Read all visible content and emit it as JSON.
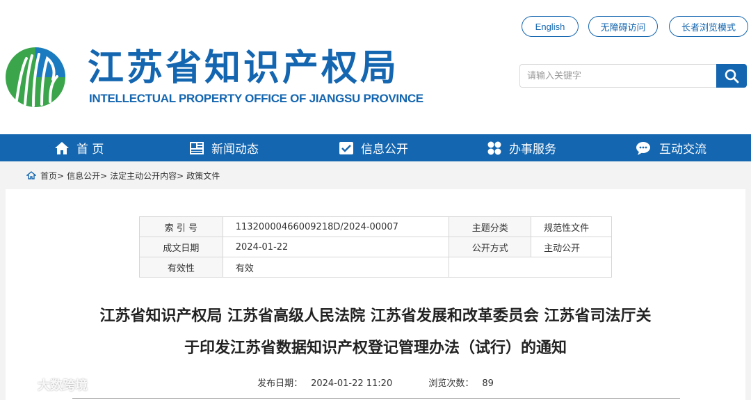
{
  "header": {
    "logo_cn": "江苏省知识产权局",
    "logo_en": "INTELLECTUAL PROPERTY OFFICE OF JIANGSU PROVINCE",
    "btn_english": "English",
    "btn_accessible": "无障碍访问",
    "btn_elder": "长者浏览模式",
    "search_placeholder": "请输入关键字",
    "brand_color": "#1466b0"
  },
  "nav": {
    "items": [
      {
        "label": "首 页",
        "icon": "home-icon"
      },
      {
        "label": "新闻动态",
        "icon": "news-icon"
      },
      {
        "label": "信息公开",
        "icon": "info-icon"
      },
      {
        "label": "办事服务",
        "icon": "service-icon"
      },
      {
        "label": "互动交流",
        "icon": "chat-icon"
      }
    ]
  },
  "breadcrumb": [
    "首页>",
    "信息公开>",
    "法定主动公开内容>",
    "政策文件"
  ],
  "meta": {
    "index_label": "索 引 号",
    "index_value": "11320000466009218D/2024-00007",
    "topic_label": "主题分类",
    "topic_value": "规范性文件",
    "date_label": "成文日期",
    "date_value": "2024-01-22",
    "mode_label": "公开方式",
    "mode_value": "主动公开",
    "valid_label": "有效性",
    "valid_value": "有效"
  },
  "article": {
    "title_line1": "江苏省知识产权局 江苏省高级人民法院 江苏省发展和改革委员会 江苏省司法厅关",
    "title_line2": "于印发江苏省数据知识产权登记管理办法（试行）的通知",
    "pub_label": "发布日期：",
    "pub_value": "2024-01-22 11:20",
    "views_label": "浏览次数：",
    "views_value": "89"
  },
  "watermark": "大数跨境"
}
